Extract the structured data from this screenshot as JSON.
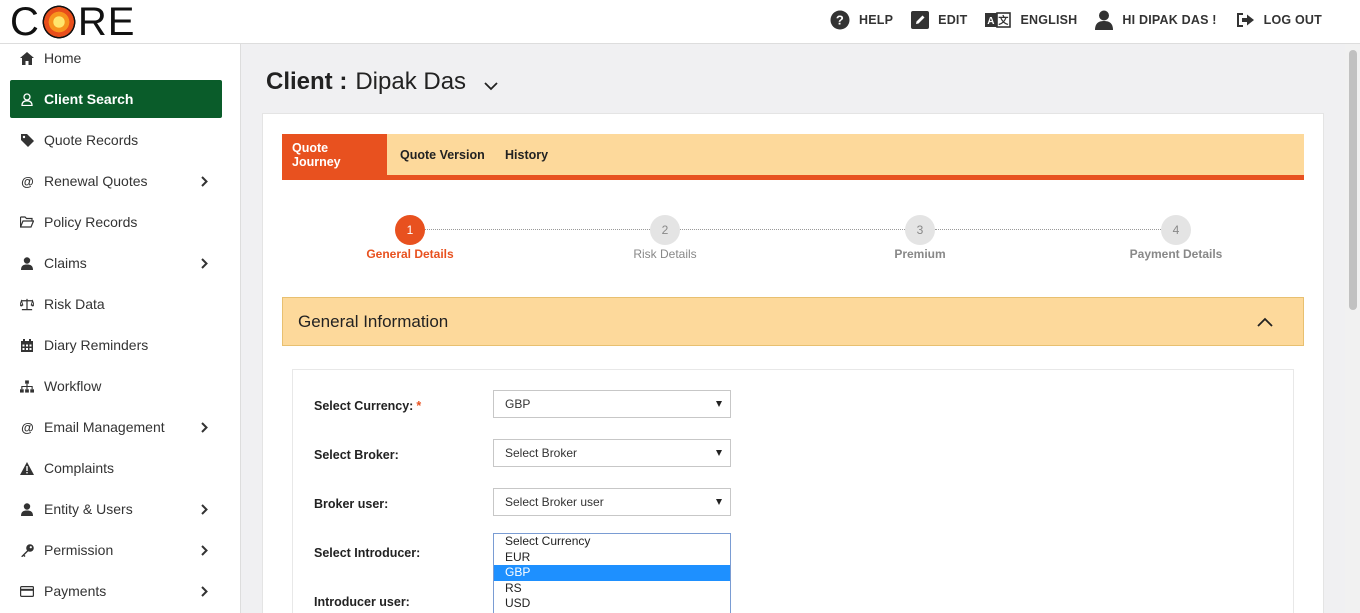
{
  "header": {
    "logo": "CORE",
    "nav": [
      {
        "label": "HELP",
        "icon": "help-icon"
      },
      {
        "label": "EDIT",
        "icon": "edit-icon"
      },
      {
        "label": "ENGLISH",
        "icon": "translate-icon"
      },
      {
        "label": "HI DIPAK DAS !",
        "icon": "user-icon"
      },
      {
        "label": "LOG OUT",
        "icon": "logout-icon"
      }
    ]
  },
  "sidebar": {
    "items": [
      {
        "label": "Home",
        "icon": "home-icon",
        "has_submenu": false,
        "active": false
      },
      {
        "label": "Client Search",
        "icon": "user-outline-icon",
        "has_submenu": false,
        "active": true
      },
      {
        "label": "Quote Records",
        "icon": "tag-icon",
        "has_submenu": false,
        "active": false
      },
      {
        "label": "Renewal Quotes",
        "icon": "at-icon",
        "has_submenu": true,
        "active": false
      },
      {
        "label": "Policy Records",
        "icon": "folder-open-icon",
        "has_submenu": false,
        "active": false
      },
      {
        "label": "Claims",
        "icon": "user-icon",
        "has_submenu": true,
        "active": false
      },
      {
        "label": "Risk Data",
        "icon": "balance-scale-icon",
        "has_submenu": false,
        "active": false
      },
      {
        "label": "Diary Reminders",
        "icon": "calendar-icon",
        "has_submenu": false,
        "active": false
      },
      {
        "label": "Workflow",
        "icon": "sitemap-icon",
        "has_submenu": false,
        "active": false
      },
      {
        "label": "Email Management",
        "icon": "at-icon",
        "has_submenu": true,
        "active": false
      },
      {
        "label": "Complaints",
        "icon": "warning-icon",
        "has_submenu": false,
        "active": false
      },
      {
        "label": "Entity & Users",
        "icon": "user-icon",
        "has_submenu": true,
        "active": false
      },
      {
        "label": "Permission",
        "icon": "key-icon",
        "has_submenu": true,
        "active": false
      },
      {
        "label": "Payments",
        "icon": "credit-card-icon",
        "has_submenu": true,
        "active": false
      }
    ]
  },
  "main": {
    "client_prefix": "Client :",
    "client_name": "Dipak Das",
    "tabs": [
      {
        "label": "Quote Journey",
        "active": true
      },
      {
        "label": "Quote Version",
        "active": false
      },
      {
        "label": "History",
        "active": false
      }
    ],
    "steps": [
      {
        "number": "1",
        "label": "General Details",
        "active": true
      },
      {
        "number": "2",
        "label": "Risk Details",
        "active": false
      },
      {
        "number": "3",
        "label": "Premium",
        "active": false
      },
      {
        "number": "4",
        "label": "Payment Details",
        "active": false
      }
    ],
    "section_title": "General Information",
    "form": {
      "currency_label": "Select Currency:",
      "currency_required": "*",
      "currency_value": "GBP",
      "broker_label": "Select Broker:",
      "broker_value": "Select Broker",
      "broker_user_label": "Broker user:",
      "broker_user_value": "Select Broker user",
      "introducer_label": "Select Introducer:",
      "introducer_user_label": "Introducer user:"
    },
    "currency_dropdown": {
      "options": [
        "Select Currency",
        "EUR",
        "GBP",
        "RS",
        "USD"
      ],
      "highlighted": "GBP"
    }
  },
  "colors": {
    "accent": "#e8511f",
    "sidebar_active": "#0a5c2a",
    "tab_bar": "#fdd99b",
    "highlight": "#1e90ff"
  }
}
